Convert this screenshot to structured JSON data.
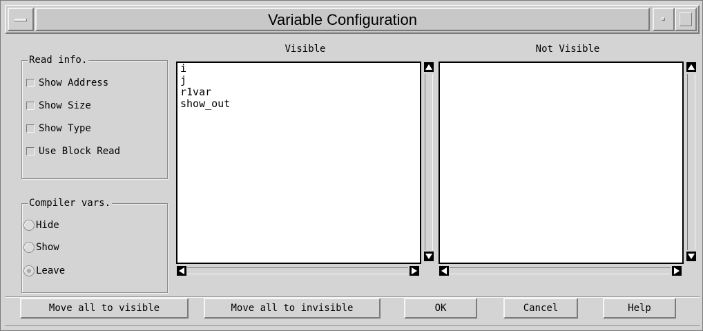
{
  "window": {
    "title": "Variable Configuration"
  },
  "read_info": {
    "title": "Read info.",
    "options": [
      {
        "label": "Show Address",
        "checked": false
      },
      {
        "label": "Show Size",
        "checked": false
      },
      {
        "label": "Show Type",
        "checked": false
      },
      {
        "label": "Use Block Read",
        "checked": false
      }
    ]
  },
  "compiler_vars": {
    "title": "Compiler vars.",
    "options": [
      {
        "label": "Hide",
        "selected": false
      },
      {
        "label": "Show",
        "selected": false
      },
      {
        "label": "Leave",
        "selected": true
      }
    ]
  },
  "visible_list": {
    "label": "Visible",
    "items": [
      "i",
      "j",
      "r1var",
      "show_out"
    ]
  },
  "not_visible_list": {
    "label": "Not Visible",
    "items": []
  },
  "buttons": {
    "move_all_visible": "Move all to visible",
    "move_all_invisible": "Move all to invisible",
    "ok": "OK",
    "cancel": "Cancel",
    "help": "Help"
  }
}
